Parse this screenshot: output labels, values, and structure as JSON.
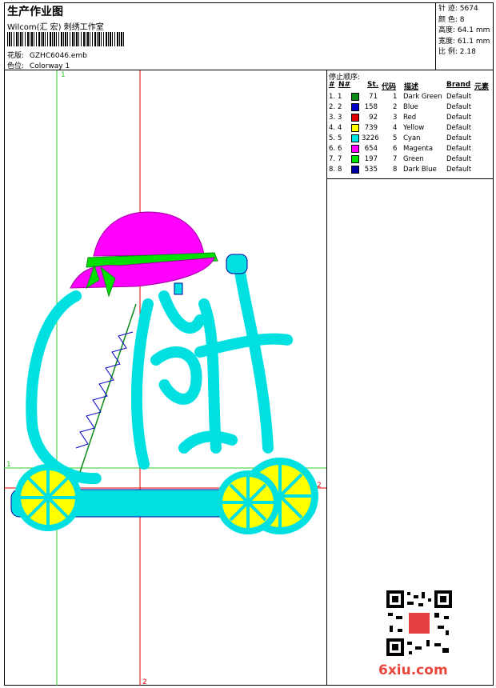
{
  "header": {
    "title": "生产作业图",
    "subtitle": "Wilcom(汇 宏) 刺绣工作室",
    "design_label": "花版:",
    "design_value": "GZHC6046.emb",
    "color_label": "色位:",
    "color_value": "Colorway 1"
  },
  "stats": [
    {
      "label": "针 迹:",
      "value": "5674"
    },
    {
      "label": "颜 色:",
      "value": "8"
    },
    {
      "label": "高度:",
      "value": "64.1 mm"
    },
    {
      "label": "宽度:",
      "value": "61.1 mm"
    },
    {
      "label": "比 例:",
      "value": "2.18"
    }
  ],
  "sequence": {
    "title": "停止顺序:",
    "headers": {
      "num": "#",
      "no": "N#",
      "st": "St.",
      "code": "代码",
      "desc": "描述",
      "brand": "Brand",
      "element": "元素"
    },
    "rows": [
      {
        "num": "1.",
        "no": "1",
        "color": "#0b8a1a",
        "st": "71",
        "code": "1",
        "desc": "Dark Green",
        "brand": "Default"
      },
      {
        "num": "2.",
        "no": "2",
        "color": "#0000c8",
        "st": "158",
        "code": "2",
        "desc": "Blue",
        "brand": "Default"
      },
      {
        "num": "3.",
        "no": "3",
        "color": "#e00000",
        "st": "92",
        "code": "3",
        "desc": "Red",
        "brand": "Default"
      },
      {
        "num": "4.",
        "no": "4",
        "color": "#ffff00",
        "st": "739",
        "code": "4",
        "desc": "Yellow",
        "brand": "Default"
      },
      {
        "num": "5.",
        "no": "5",
        "color": "#00e5e5",
        "st": "3226",
        "code": "5",
        "desc": "Cyan",
        "brand": "Default"
      },
      {
        "num": "6.",
        "no": "6",
        "color": "#ff00ff",
        "st": "654",
        "code": "6",
        "desc": "Magenta",
        "brand": "Default"
      },
      {
        "num": "7.",
        "no": "7",
        "color": "#00e000",
        "st": "197",
        "code": "7",
        "desc": "Green",
        "brand": "Default"
      },
      {
        "num": "8.",
        "no": "8",
        "color": "#0000a0",
        "st": "535",
        "code": "8",
        "desc": "Dark Blue",
        "brand": "Default"
      }
    ]
  },
  "guides": {
    "v1": "1",
    "h1": "1",
    "v2": "2",
    "h2": "2"
  },
  "watermark": "6xiu.com"
}
